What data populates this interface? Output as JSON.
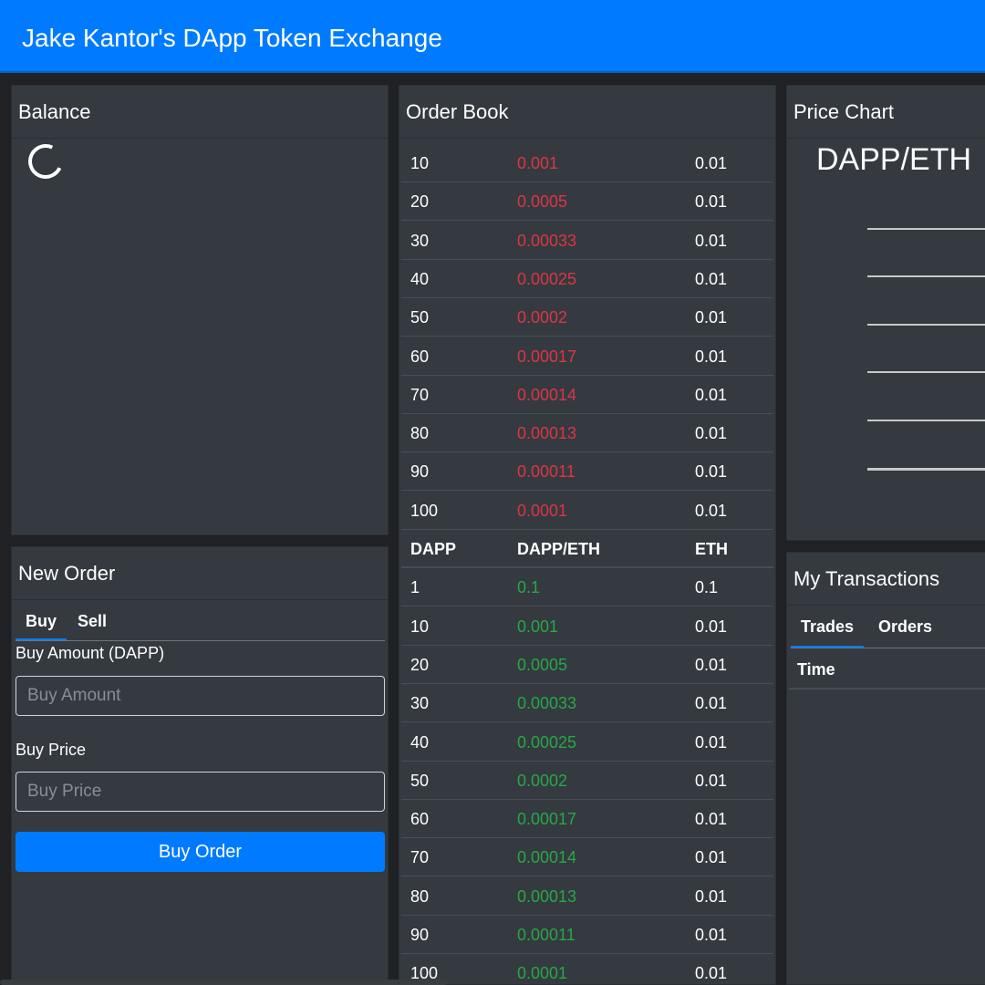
{
  "app": {
    "title": "Jake Kantor's DApp Token Exchange"
  },
  "balance": {
    "header": "Balance"
  },
  "new_order": {
    "header": "New Order",
    "tabs": [
      "Buy",
      "Sell"
    ],
    "amount_label": "Buy Amount (DAPP)",
    "amount_placeholder": "Buy Amount",
    "price_label": "Buy Price",
    "price_placeholder": "Buy Price",
    "submit_label": "Buy Order"
  },
  "order_book": {
    "header": "Order Book",
    "sell_orders": [
      [
        "10",
        "0.001",
        "0.01"
      ],
      [
        "20",
        "0.0005",
        "0.01"
      ],
      [
        "30",
        "0.00033",
        "0.01"
      ],
      [
        "40",
        "0.00025",
        "0.01"
      ],
      [
        "50",
        "0.0002",
        "0.01"
      ],
      [
        "60",
        "0.00017",
        "0.01"
      ],
      [
        "70",
        "0.00014",
        "0.01"
      ],
      [
        "80",
        "0.00013",
        "0.01"
      ],
      [
        "90",
        "0.00011",
        "0.01"
      ],
      [
        "100",
        "0.0001",
        "0.01"
      ]
    ],
    "columns": [
      "DAPP",
      "DAPP/ETH",
      "ETH"
    ],
    "buy_orders": [
      [
        "1",
        "0.1",
        "0.1"
      ],
      [
        "10",
        "0.001",
        "0.01"
      ],
      [
        "20",
        "0.0005",
        "0.01"
      ],
      [
        "30",
        "0.00033",
        "0.01"
      ],
      [
        "40",
        "0.00025",
        "0.01"
      ],
      [
        "50",
        "0.0002",
        "0.01"
      ],
      [
        "60",
        "0.00017",
        "0.01"
      ],
      [
        "70",
        "0.00014",
        "0.01"
      ],
      [
        "80",
        "0.00013",
        "0.01"
      ],
      [
        "90",
        "0.00011",
        "0.01"
      ],
      [
        "100",
        "0.0001",
        "0.01"
      ]
    ]
  },
  "price_chart": {
    "header": "Price Chart",
    "pair": "DAPP/ETH"
  },
  "my_transactions": {
    "header": "My Transactions",
    "tabs": [
      "Trades",
      "Orders"
    ],
    "columns": [
      "Time"
    ]
  },
  "colors": {
    "accent": "#007bff",
    "sell": "#dc3545",
    "buy": "#28a745",
    "card": "#343a40"
  }
}
